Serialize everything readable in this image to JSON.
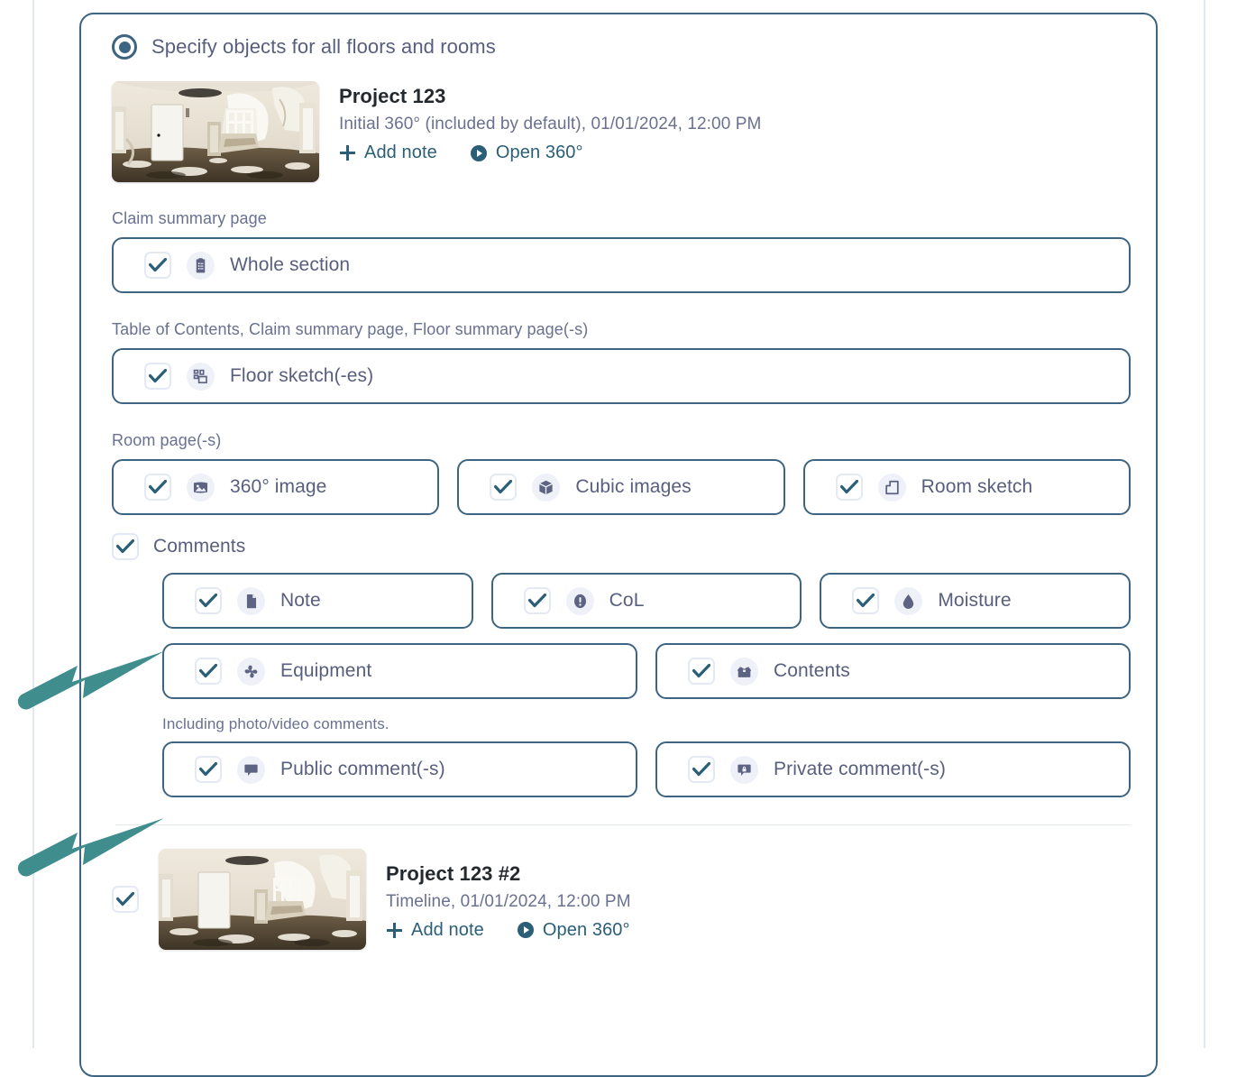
{
  "colors": {
    "card_border": "#3d6480",
    "pill_border": "#3d6480",
    "check_mark": "#2b5f77",
    "label_text": "#585f7e",
    "muted_text": "#6a7190",
    "link_text": "#2b5f77",
    "icon_fill": "#5d6383",
    "icon_badge_bg": "#eef1f8",
    "arrow_annotation": "#3f8d8d",
    "rail": "#e3e8f0"
  },
  "scope": {
    "radio_label": "Specify objects for all floors and rooms",
    "radio_selected": true
  },
  "project": {
    "title": "Project 123",
    "subtitle": "Initial 360° (included by default), 01/01/2024, 12:00 PM",
    "add_note_label": "Add note",
    "open_360_label": "Open 360°",
    "thumbnail_alt": "360° panorama of damaged interior with staircase"
  },
  "sections": [
    {
      "label": "Claim summary page",
      "options": [
        {
          "label": "Whole section",
          "icon": "clipboard-list-icon",
          "checked": true
        }
      ]
    },
    {
      "label": "Table of Contents, Claim summary page, Floor summary page(-s)",
      "options": [
        {
          "label": "Floor sketch(-es)",
          "icon": "floor-plan-icon",
          "checked": true
        }
      ]
    },
    {
      "label": "Room page(-s)",
      "options": [
        {
          "label": "360° image",
          "icon": "panorama-image-icon",
          "checked": true
        },
        {
          "label": "Cubic images",
          "icon": "cube-icon",
          "checked": true
        },
        {
          "label": "Room sketch",
          "icon": "room-outline-icon",
          "checked": true
        }
      ]
    }
  ],
  "comments": {
    "group_label": "Comments",
    "group_checked": true,
    "types_row1": [
      {
        "label": "Note",
        "icon": "document-icon",
        "checked": true
      },
      {
        "label": "CoL",
        "icon": "exclamation-circle-icon",
        "checked": true
      },
      {
        "label": "Moisture",
        "icon": "water-drop-icon",
        "checked": true
      }
    ],
    "types_row2": [
      {
        "label": "Equipment",
        "icon": "fan-icon",
        "checked": true
      },
      {
        "label": "Contents",
        "icon": "open-box-icon",
        "checked": true
      }
    ],
    "note_text": "Including photo/video comments.",
    "visibility": [
      {
        "label": "Public comment(-s)",
        "icon": "speech-bubble-icon",
        "checked": true
      },
      {
        "label": "Private comment(-s)",
        "icon": "speech-bubble-lock-icon",
        "checked": true
      }
    ]
  },
  "project2": {
    "checked": true,
    "title": "Project 123 #2",
    "subtitle": "Timeline, 01/01/2024, 12:00 PM",
    "add_note_label": "Add note",
    "open_360_label": "Open 360°",
    "thumbnail_alt": "360° panorama of damaged interior with staircase"
  }
}
